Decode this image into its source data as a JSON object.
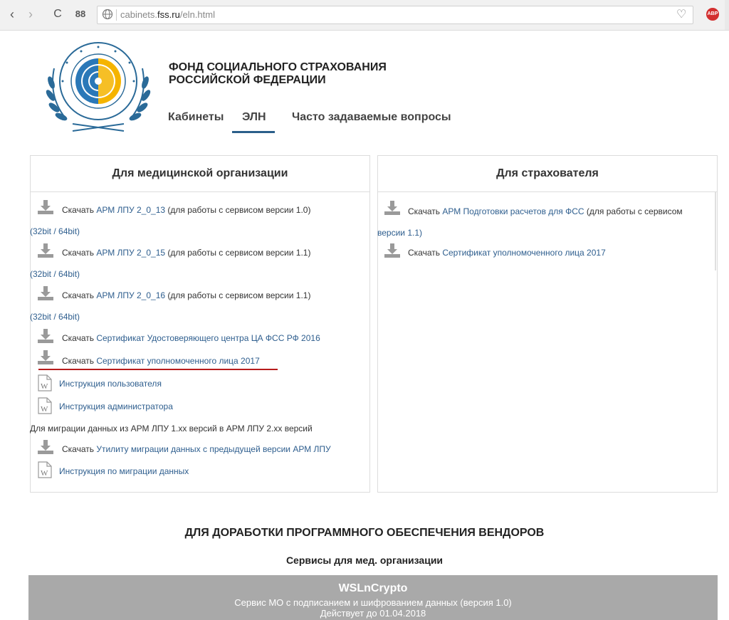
{
  "browser": {
    "back": "‹",
    "forward": "›",
    "reload": "C",
    "grid": "88",
    "url_prefix": "cabinets.",
    "url_domain": "fss.ru",
    "url_path": "/eln.html"
  },
  "header": {
    "org_line1": "ФОНД СОЦИАЛЬНОГО СТРАХОВАНИЯ",
    "org_line2": "РОССИЙСКОЙ ФЕДЕРАЦИИ",
    "nav": [
      "Кабинеты",
      "ЭЛН",
      "Часто задаваемые вопросы"
    ],
    "active_nav": "ЭЛН"
  },
  "medical_panel": {
    "title": "Для медицинской организации",
    "items": [
      {
        "prefix": "Скачать ",
        "link": "АРМ ЛПУ 2_0_13",
        "suffix": " (для работы с сервисом версии 1.0)",
        "extra": "(32bit / 64bit)"
      },
      {
        "prefix": "Скачать ",
        "link": "АРМ ЛПУ 2_0_15",
        "suffix": " (для работы с сервисом версии 1.1)",
        "extra": "(32bit / 64bit)"
      },
      {
        "prefix": "Скачать ",
        "link": "АРМ ЛПУ 2_0_16",
        "suffix": " (для работы с сервисом версии 1.1)",
        "extra": "(32bit / 64bit)"
      },
      {
        "prefix": "Скачать ",
        "link": "Сертификат Удостоверяющего центра ЦА ФСС РФ 2016"
      },
      {
        "prefix": "Скачать ",
        "link": "Сертификат уполномоченного лица 2017"
      },
      {
        "link": "Инструкция пользователя"
      },
      {
        "link": "Инструкция администратора"
      },
      {
        "text": "Для миграции данных из АРМ ЛПУ 1.xx версий в АРМ ЛПУ 2.xx версий"
      },
      {
        "prefix": "Скачать ",
        "link": "Утилиту миграции данных с предыдущей версии АРМ ЛПУ"
      },
      {
        "link": "Инструкция по миграции данных"
      }
    ]
  },
  "insurer_panel": {
    "title": "Для страхователя",
    "items": [
      {
        "prefix": "Скачать ",
        "link": "АРМ Подготовки расчетов для ФСС",
        "suffix": " (для работы с сервисом",
        "extra": "версии 1.1)"
      },
      {
        "prefix": "Скачать ",
        "link": "Сертификат уполномоченного лица 2017"
      }
    ]
  },
  "vendor": {
    "title": "ДЛЯ ДОРАБОТКИ ПРОГРАММНОГО ОБЕСПЕЧЕНИЯ ВЕНДОРОВ",
    "subtitle": "Сервисы для мед. организации",
    "service_name": "WSLnCrypto",
    "service_desc": "Сервис МО с подписанием и шифрованием данных (версия 1.0)",
    "service_valid": "Действует до 01.04.2018"
  },
  "colors": {
    "link": "#2e5e8e",
    "accent": "#2b5f8a",
    "highlight_line": "#b71c1c",
    "service_bg": "#a9a9a9"
  }
}
